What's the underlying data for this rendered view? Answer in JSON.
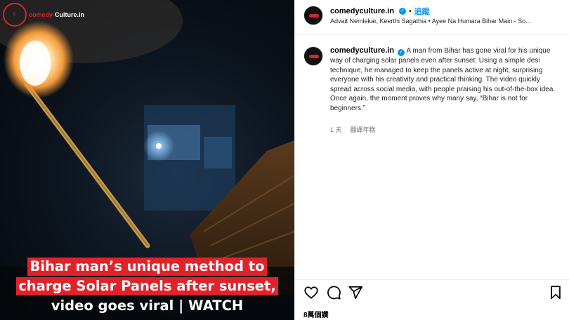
{
  "media": {
    "brand": {
      "prefix": "comedy",
      "suffix": "Culture.in",
      "ring_text": "C"
    },
    "caption": {
      "line1": "Bihar man’s unique method to",
      "line2": "charge Solar Panels after sunset,",
      "line3": "video goes viral | WATCH"
    },
    "colors": {
      "caption_bg": "#e0232b",
      "brand": "#d4252a"
    }
  },
  "header": {
    "username": "comedyculture.in",
    "verified_icon": "verified-badge-icon",
    "separator": "•",
    "follow_label": "追蹤",
    "audio": "Advait Nemlekar, Keerthi Sagathia • Ayee Na Humara Bihar Main - So..."
  },
  "caption_comment": {
    "username": "comedyculture.in",
    "text": "A man from Bihar has gone viral for his unique way of charging solar panels even after sunset. Using a simple desi technique, he managed to keep the panels active at night, surprising everyone with his creativity and practical thinking. The video quickly spread across social media, with people praising his out-of-the-box idea. Once again, the moment proves why many say, “Bihar is not for beginners.”",
    "time": "1 天",
    "translate_label": "翻譯年糕"
  },
  "actions": {
    "like_icon": "heart-icon",
    "comment_icon": "comment-icon",
    "share_icon": "send-icon",
    "save_icon": "bookmark-icon"
  },
  "likes": "8萬個讚",
  "colors": {
    "link": "#0095f6",
    "muted": "#737373",
    "verified": "#0095f6"
  }
}
